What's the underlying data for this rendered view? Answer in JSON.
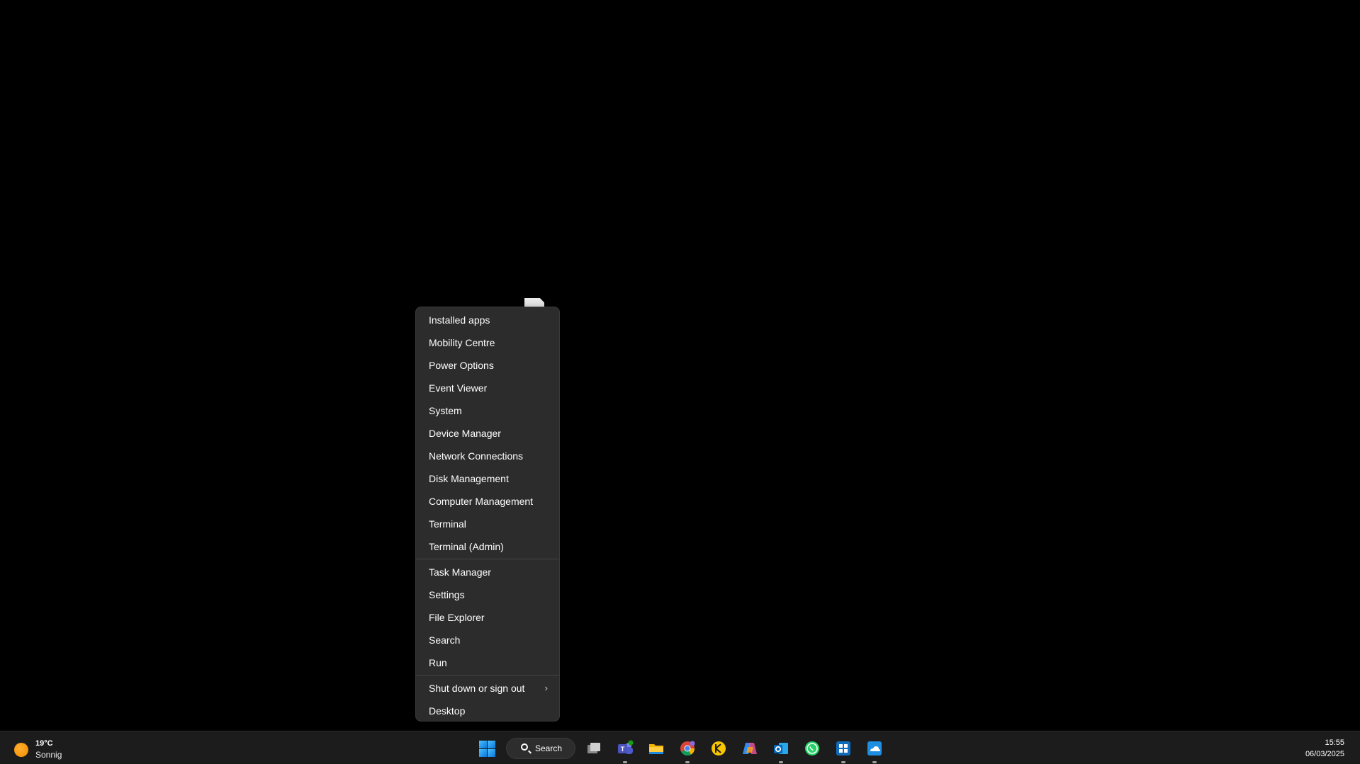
{
  "menu": {
    "group1": [
      "Installed apps",
      "Mobility Centre",
      "Power Options",
      "Event Viewer",
      "System",
      "Device Manager",
      "Network Connections",
      "Disk Management",
      "Computer Management",
      "Terminal",
      "Terminal (Admin)"
    ],
    "group2": [
      "Task Manager",
      "Settings",
      "File Explorer",
      "Search",
      "Run"
    ],
    "group3": {
      "shutdown": "Shut down or sign out",
      "shutdown_arrow": "›",
      "desktop": "Desktop"
    }
  },
  "taskbar": {
    "weather": {
      "temp": "19°C",
      "condition": "Sonnig",
      "icon": "sun-icon"
    },
    "search_label": "Search",
    "apps": [
      {
        "name": "task-view-icon",
        "running": false
      },
      {
        "name": "teams-icon",
        "running": true
      },
      {
        "name": "file-explorer-icon",
        "running": false
      },
      {
        "name": "chrome-icon",
        "running": true
      },
      {
        "name": "keeper-icon",
        "running": false
      },
      {
        "name": "copilot-icon",
        "running": false
      },
      {
        "name": "outlook-icon",
        "running": true
      },
      {
        "name": "whatsapp-icon",
        "running": false
      },
      {
        "name": "windows-app-icon",
        "running": true
      },
      {
        "name": "onedrive-app-icon",
        "running": true
      }
    ],
    "clock": {
      "time": "15:55",
      "date": "06/03/2025"
    }
  },
  "colors": {
    "desktop": "#000000",
    "menu_bg": "#2c2c2c",
    "taskbar_bg": "#1c1c1c",
    "accent": "#0a74d8"
  }
}
